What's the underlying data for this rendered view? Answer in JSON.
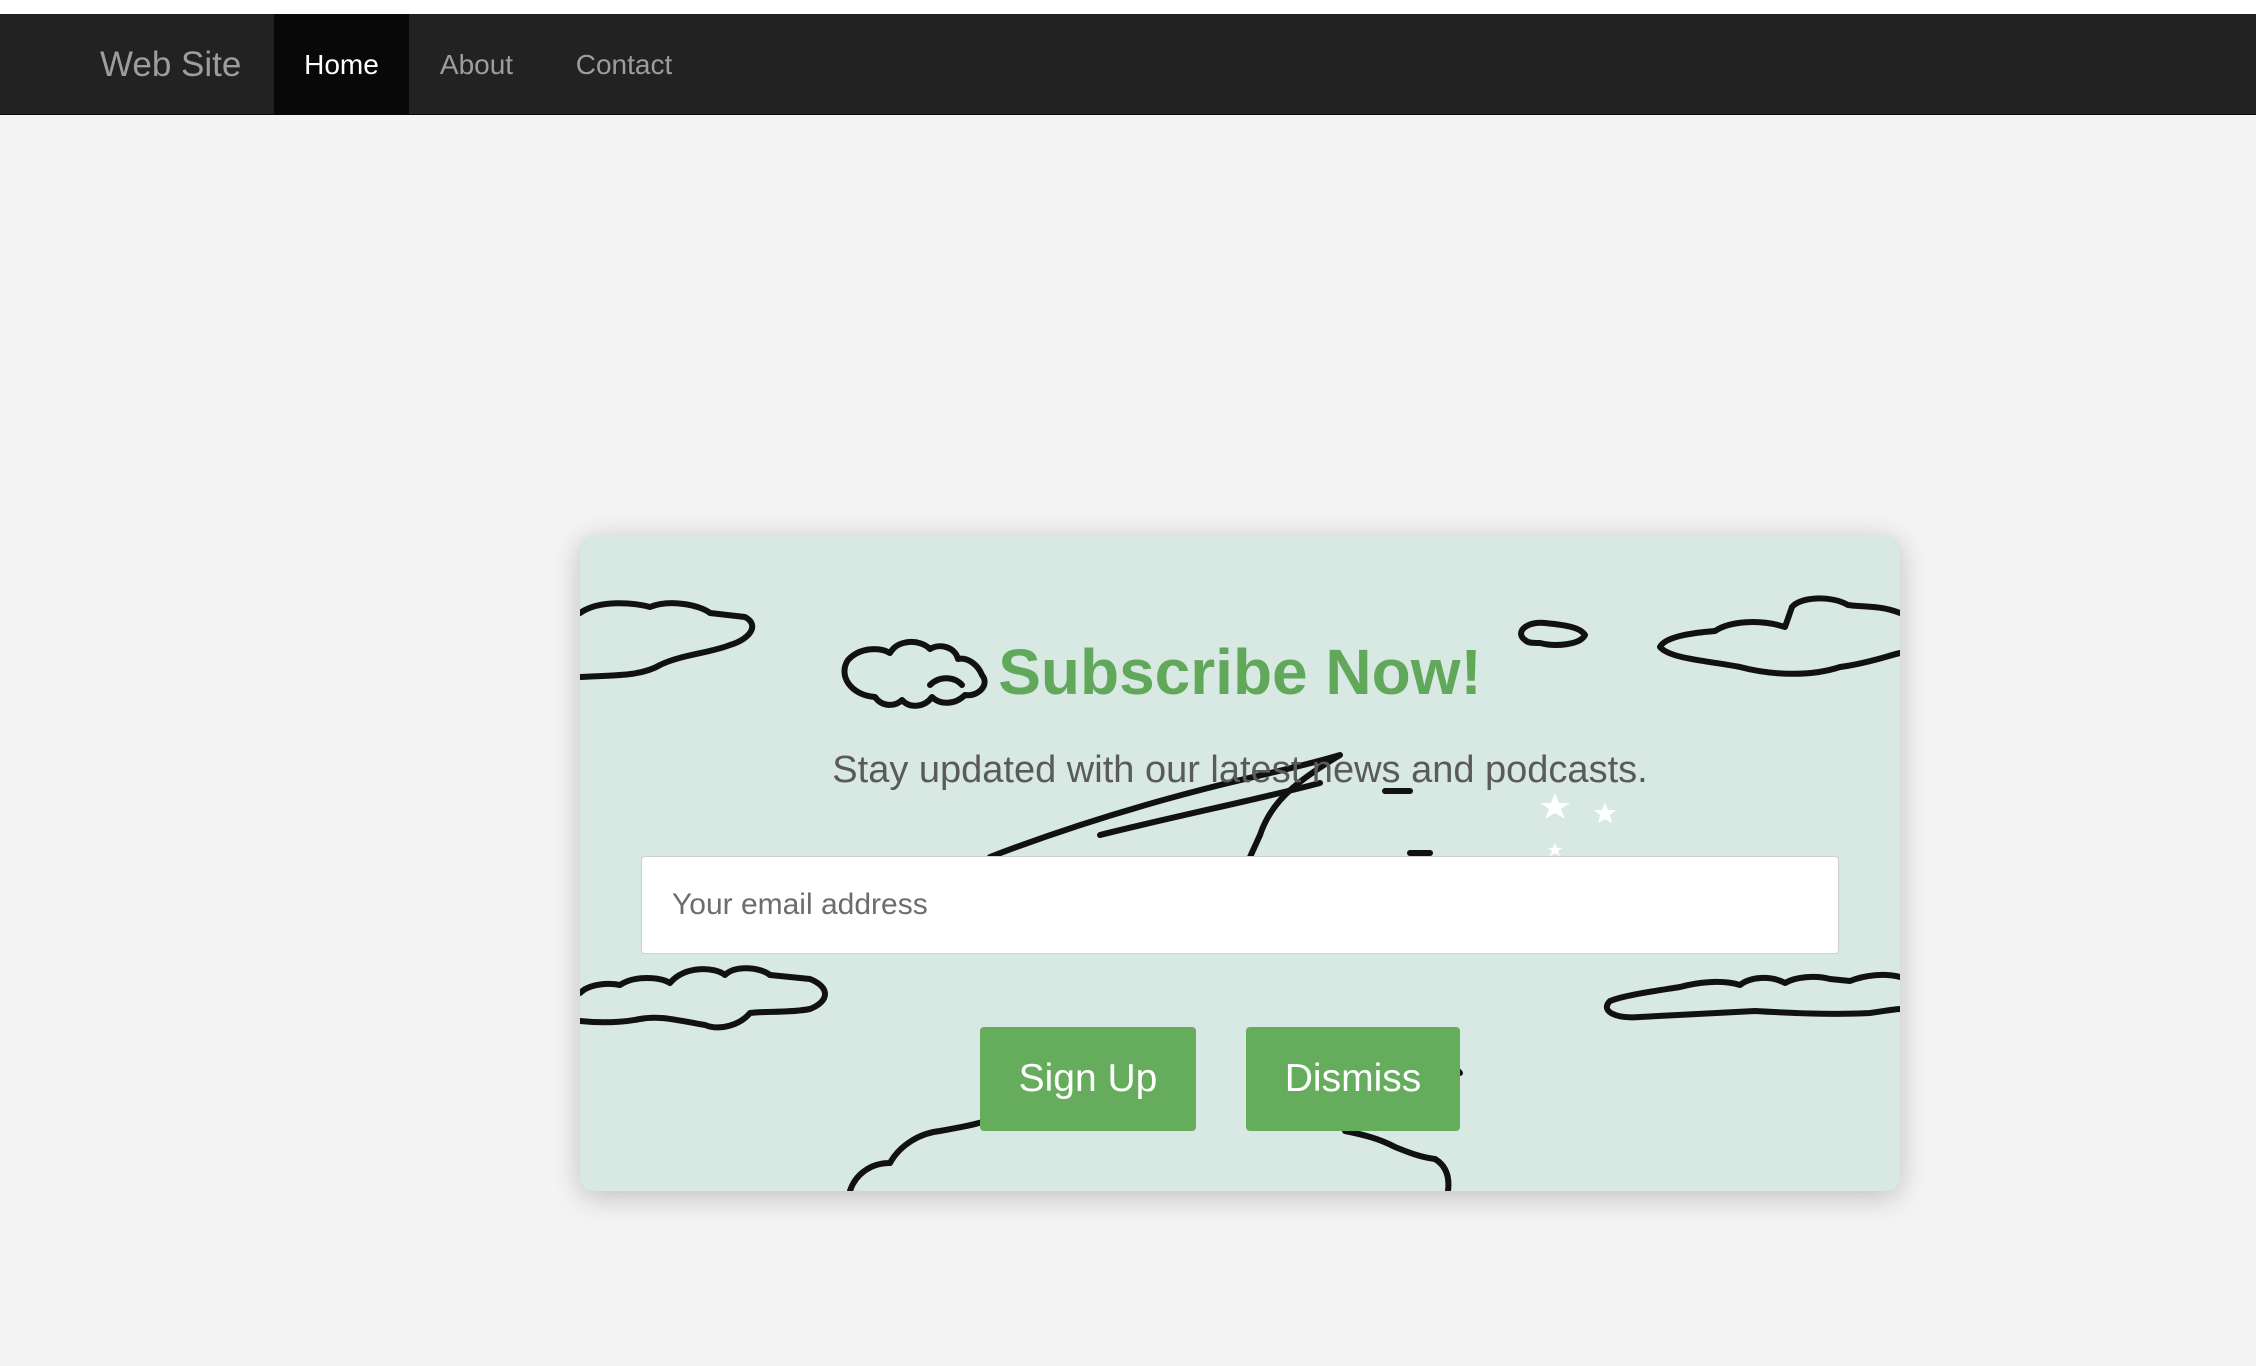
{
  "navbar": {
    "brand": "Web Site",
    "items": [
      {
        "label": "Home",
        "active": true
      },
      {
        "label": "About",
        "active": false
      },
      {
        "label": "Contact",
        "active": false
      }
    ]
  },
  "modal": {
    "title": "Subscribe Now!",
    "subtitle": "Stay updated with our latest news and podcasts.",
    "email_placeholder": "Your email address",
    "email_value": "",
    "signup_label": "Sign Up",
    "dismiss_label": "Dismiss"
  },
  "colors": {
    "navbar_bg": "#222222",
    "active_tab_bg": "#080808",
    "accent_green": "#65ad5d",
    "modal_bg": "#d8e8e2",
    "page_bg": "#f4f4f4"
  }
}
